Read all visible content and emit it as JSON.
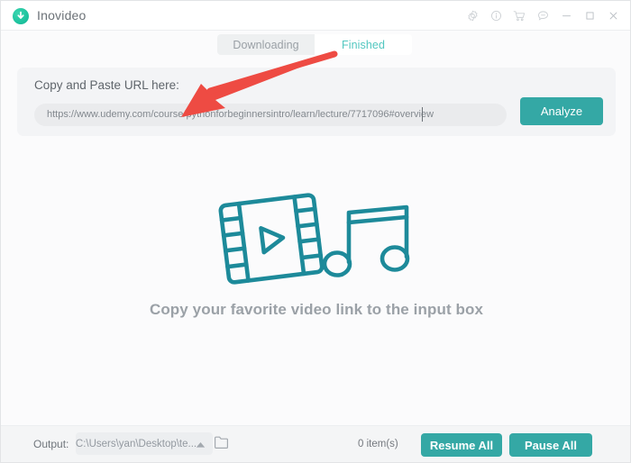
{
  "window": {
    "title": "Inovideo",
    "logo_icon": "download-circle-icon",
    "controls": [
      {
        "name": "settings",
        "icon": "gear-icon"
      },
      {
        "name": "info",
        "icon": "info-circle-icon"
      },
      {
        "name": "store",
        "icon": "shopping-cart-icon"
      },
      {
        "name": "feedback",
        "icon": "chat-bubble-icon"
      },
      {
        "name": "minimize",
        "icon": "minimize-icon"
      },
      {
        "name": "maximize",
        "icon": "maximize-icon"
      },
      {
        "name": "close",
        "icon": "close-icon"
      }
    ]
  },
  "tabs": [
    {
      "label": "Downloading",
      "active": false
    },
    {
      "label": "Finished",
      "active": true
    }
  ],
  "url_panel": {
    "label": "Copy and Paste URL here:",
    "input_value": "https://www.udemy.com/course/pythonforbeginnersintro/learn/lecture/7717096#overview",
    "input_placeholder": "Copy and Paste URL here",
    "analyze_label": "Analyze"
  },
  "empty_state": {
    "message": "Copy your favorite video link to the input box",
    "art_icons": [
      "film-strip-play-icon",
      "music-note-icon"
    ]
  },
  "bottom_bar": {
    "output_label": "Output:",
    "output_path": "C:\\Users\\yan\\Desktop\\te...",
    "folder_icon": "folder-icon",
    "path_caret_icon": "caret-up-icon",
    "item_count": "0 item(s)",
    "resume_all_label": "Resume All",
    "pause_all_label": "Pause All"
  },
  "annotation": {
    "arrow_color": "#ee4b43",
    "arrow_from": "370,60",
    "arrow_to": "200,128"
  },
  "colors": {
    "accent_teal": "#34a8a5",
    "tab_active_text": "#52c7c0",
    "art_stroke": "#1d8a9a",
    "panel_bg": "#f3f4f6",
    "window_bg": "#fbfbfc"
  }
}
